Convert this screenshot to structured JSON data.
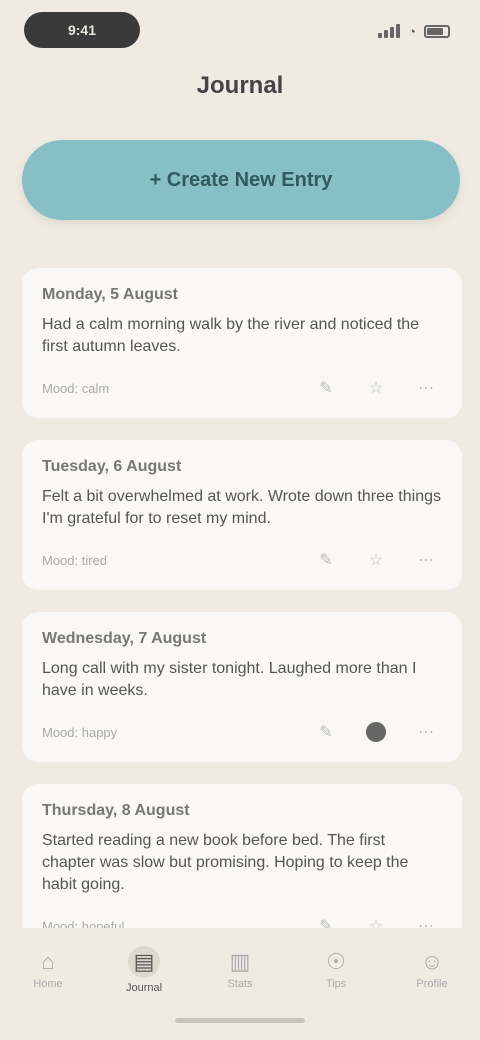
{
  "status": {
    "time": "9:41"
  },
  "header": {
    "title": "Journal"
  },
  "actions": {
    "create_label": "+ Create New Entry"
  },
  "entries": [
    {
      "date": "Monday, 5 August",
      "text": "Had a calm morning walk by the river and noticed the first autumn leaves.",
      "meta": "Mood: calm"
    },
    {
      "date": "Tuesday, 6 August",
      "text": "Felt a bit overwhelmed at work. Wrote down three things I'm grateful for to reset my mind.",
      "meta": "Mood: tired"
    },
    {
      "date": "Wednesday, 7 August",
      "text": "Long call with my sister tonight. Laughed more than I have in weeks.",
      "meta": "Mood: happy"
    },
    {
      "date": "Thursday, 8 August",
      "text": "Started reading a new book before bed. The first chapter was slow but promising. Hoping to keep the habit going.",
      "meta": "Mood: hopeful"
    }
  ],
  "tabs": [
    {
      "label": "Home",
      "icon": "home-icon"
    },
    {
      "label": "Journal",
      "icon": "book-icon"
    },
    {
      "label": "Stats",
      "icon": "chart-icon"
    },
    {
      "label": "Tips",
      "icon": "bulb-icon"
    },
    {
      "label": "Profile",
      "icon": "user-icon"
    }
  ]
}
